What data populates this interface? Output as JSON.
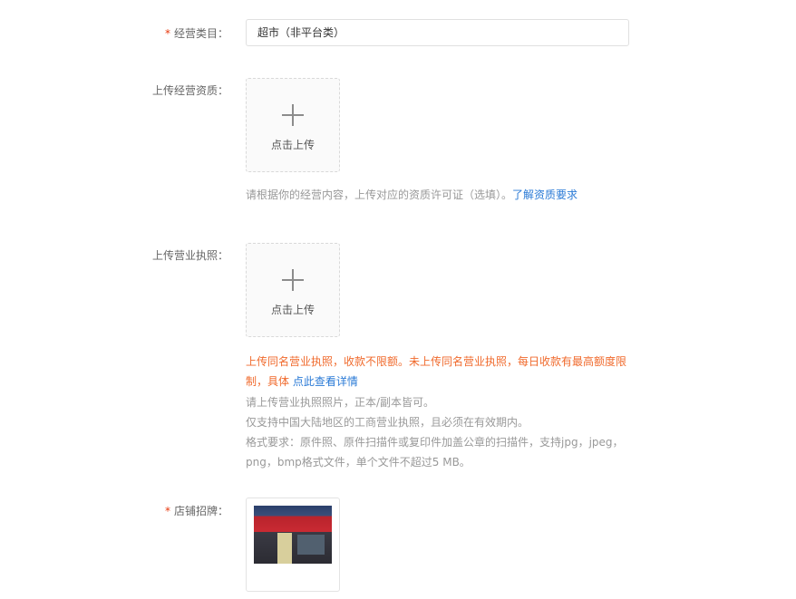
{
  "category": {
    "label": "经营类目：",
    "value": "超市（非平台类）"
  },
  "qualification": {
    "label": "上传经营资质：",
    "upload_text": "点击上传",
    "hint": "请根据你的经营内容，上传对应的资质许可证（选填）。",
    "hint_link": "了解资质要求"
  },
  "license": {
    "label": "上传营业执照：",
    "upload_text": "点击上传",
    "warning": "上传同名营业执照，收款不限额。未上传同名营业执照，每日收款有最高额度限制，具体",
    "warning_link": "点此查看详情",
    "note1": "请上传营业执照照片，正本/副本皆可。",
    "note2": "仅支持中国大陆地区的工商营业执照，且必须在有效期内。",
    "note3": "格式要求：原件照、原件扫描件或复印件加盖公章的扫描件，支持jpg，jpeg，png，bmp格式文件，单个文件不超过5 MB。"
  },
  "signboard": {
    "label": "店铺招牌："
  },
  "required_mark": "*",
  "colors": {
    "required": "#e8380d",
    "link": "#2a7ad6",
    "warning": "#f06a2c",
    "hint": "#999999"
  }
}
